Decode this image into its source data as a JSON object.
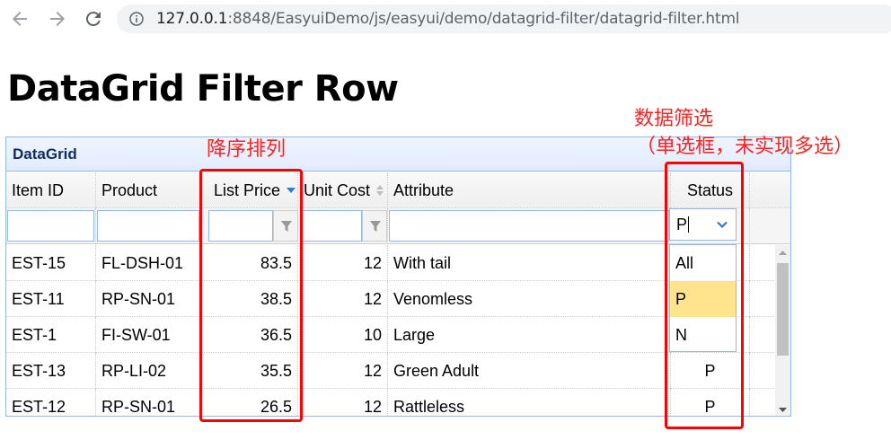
{
  "browser": {
    "url_host": "127.0.0.1",
    "url_rest": ":8848/EasyuiDemo/js/easyui/demo/datagrid-filter/datagrid-filter.html"
  },
  "page": {
    "title": "DataGrid Filter Row"
  },
  "panel": {
    "title": "DataGrid"
  },
  "columns": [
    {
      "label": "Item ID"
    },
    {
      "label": "Product"
    },
    {
      "label": "List Price"
    },
    {
      "label": "Unit Cost"
    },
    {
      "label": "Attribute"
    },
    {
      "label": "Status"
    }
  ],
  "filter": {
    "status_value": "P"
  },
  "rows": [
    {
      "itemid": "EST-15",
      "product": "FL-DSH-01",
      "listprice": "83.5",
      "unitcost": "12",
      "attr": "With tail",
      "status": ""
    },
    {
      "itemid": "EST-11",
      "product": "RP-SN-01",
      "listprice": "38.5",
      "unitcost": "12",
      "attr": "Venomless",
      "status": ""
    },
    {
      "itemid": "EST-1",
      "product": "FI-SW-01",
      "listprice": "36.5",
      "unitcost": "10",
      "attr": "Large",
      "status": ""
    },
    {
      "itemid": "EST-13",
      "product": "RP-LI-02",
      "listprice": "35.5",
      "unitcost": "12",
      "attr": "Green Adult",
      "status": "P"
    },
    {
      "itemid": "EST-12",
      "product": "RP-SN-01",
      "listprice": "26.5",
      "unitcost": "12",
      "attr": "Rattleless",
      "status": "P"
    }
  ],
  "combo_options": [
    {
      "label": "All",
      "selected": false
    },
    {
      "label": "P",
      "selected": true
    },
    {
      "label": "N",
      "selected": false
    }
  ],
  "annotations": {
    "sort_note": "降序排列",
    "filter_note_line1": "数据筛选",
    "filter_note_line2": "（单选框，未实现多选）"
  },
  "colors": {
    "annotation_red": "#ff0000",
    "panel_border": "#95b8e7",
    "panel_title": "#0e2d5f",
    "selected_item": "#ffe48d",
    "sort_arrow": "#2d7ad0"
  }
}
